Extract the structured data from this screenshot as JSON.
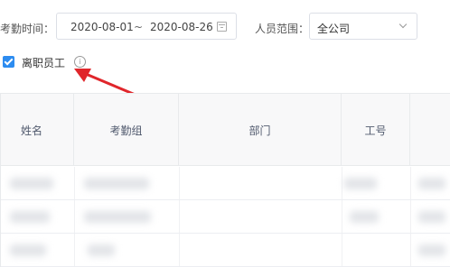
{
  "filters": {
    "attendance_time_label": "考勤时间：",
    "date_start": "2020-08-01",
    "date_separator": "~",
    "date_end": "2020-08-26",
    "calendar_icon": "calendar-icon",
    "personnel_scope_label": "人员范围：",
    "personnel_scope_value": "全公司",
    "dropdown_icon": "chevron-down-icon"
  },
  "options": {
    "include_resigned_label": "离职员工",
    "include_resigned_checked": true,
    "info_icon_glyph": "i"
  },
  "table": {
    "columns": [
      "姓名",
      "考勤组",
      "部门",
      "工号",
      ""
    ]
  },
  "colors": {
    "accent": "#2d8cf0",
    "annotation_arrow": "#e0262b"
  }
}
